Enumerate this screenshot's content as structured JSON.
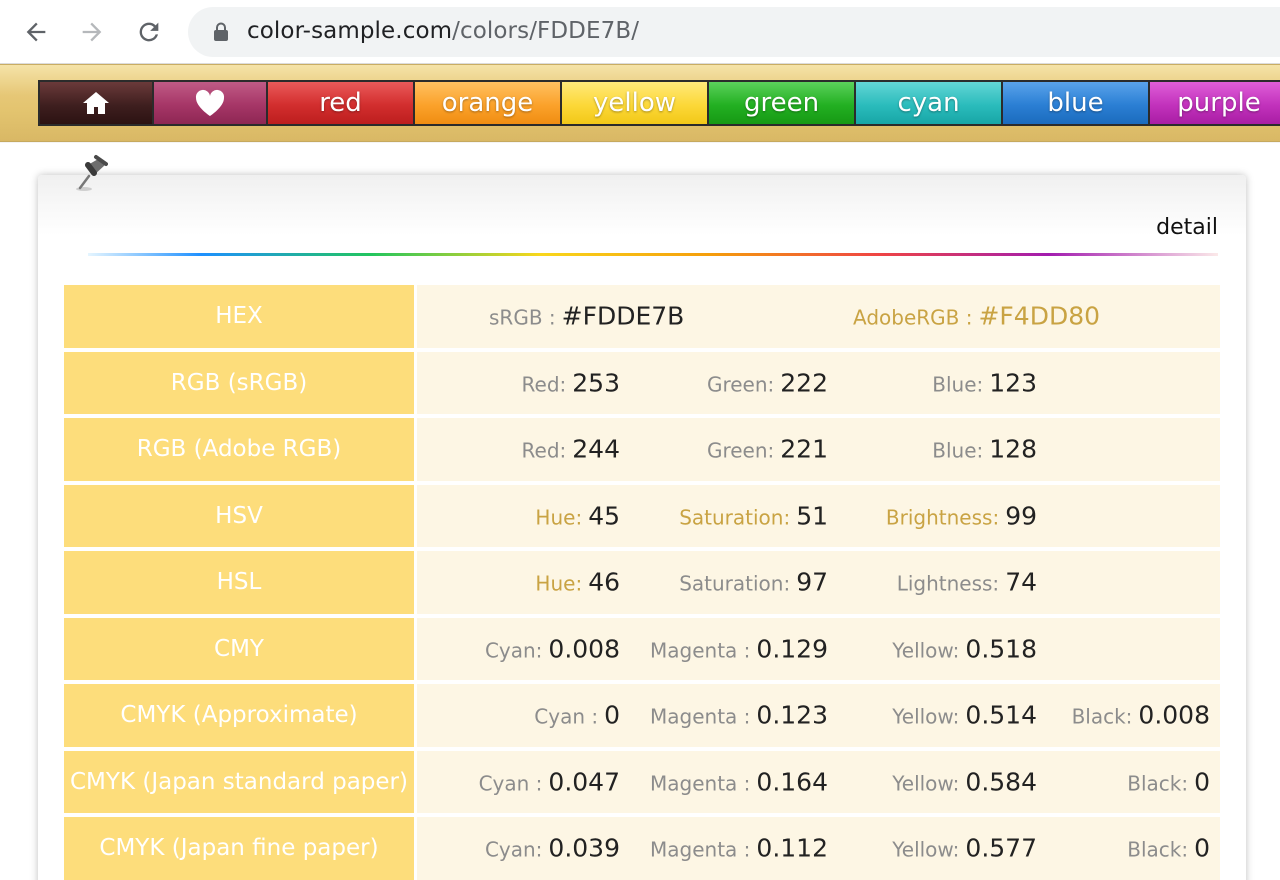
{
  "browser": {
    "url_domain": "color-sample.com",
    "url_path": "/colors/FDDE7B/"
  },
  "color_tabs": [
    {
      "id": "home",
      "label": "",
      "icon": "home-icon"
    },
    {
      "id": "fav",
      "label": "",
      "icon": "heart-icon"
    },
    {
      "id": "red",
      "label": "red"
    },
    {
      "id": "orange",
      "label": "orange"
    },
    {
      "id": "yellow",
      "label": "yellow"
    },
    {
      "id": "green",
      "label": "green"
    },
    {
      "id": "cyan",
      "label": "cyan"
    },
    {
      "id": "blue",
      "label": "blue"
    },
    {
      "id": "purple",
      "label": "purple"
    }
  ],
  "detail": {
    "title": "detail",
    "rows": [
      {
        "label": "HEX",
        "fields": [
          {
            "key": "sRGB :",
            "value": "#FDDE7B"
          },
          {
            "key": "AdobeRGB :",
            "value": "#F4DD80",
            "highlight": true
          }
        ]
      },
      {
        "label": "RGB (sRGB)",
        "fields": [
          {
            "key": "Red:",
            "value": "253"
          },
          {
            "key": "Green:",
            "value": "222"
          },
          {
            "key": "Blue:",
            "value": "123"
          }
        ]
      },
      {
        "label": "RGB (Adobe RGB)",
        "fields": [
          {
            "key": "Red:",
            "value": "244"
          },
          {
            "key": "Green:",
            "value": "221"
          },
          {
            "key": "Blue:",
            "value": "128"
          }
        ]
      },
      {
        "label": "HSV",
        "fields": [
          {
            "key": "Hue:",
            "value": "45",
            "highlight": true
          },
          {
            "key": "Saturation:",
            "value": "51",
            "highlight": true
          },
          {
            "key": "Brightness:",
            "value": "99",
            "highlight": true
          }
        ]
      },
      {
        "label": "HSL",
        "fields": [
          {
            "key": "Hue:",
            "value": "46",
            "highlight": true
          },
          {
            "key": "Saturation:",
            "value": "97"
          },
          {
            "key": "Lightness:",
            "value": "74"
          }
        ]
      },
      {
        "label": "CMY",
        "fields": [
          {
            "key": "Cyan:",
            "value": "0.008"
          },
          {
            "key": "Magenta :",
            "value": "0.129"
          },
          {
            "key": "Yellow:",
            "value": "0.518"
          }
        ]
      },
      {
        "label": "CMYK (Approximate)",
        "fields": [
          {
            "key": "Cyan :",
            "value": "0"
          },
          {
            "key": "Magenta :",
            "value": "0.123"
          },
          {
            "key": "Yellow:",
            "value": "0.514"
          },
          {
            "key": "Black:",
            "value": "0.008"
          }
        ]
      },
      {
        "label": "CMYK (Japan standard paper)",
        "fields": [
          {
            "key": "Cyan :",
            "value": "0.047"
          },
          {
            "key": "Magenta :",
            "value": "0.164"
          },
          {
            "key": "Yellow:",
            "value": "0.584"
          },
          {
            "key": "Black:",
            "value": "0"
          }
        ]
      },
      {
        "label": "CMYK (Japan fine paper)",
        "fields": [
          {
            "key": "Cyan:",
            "value": "0.039"
          },
          {
            "key": "Magenta :",
            "value": "0.112"
          },
          {
            "key": "Yellow:",
            "value": "0.577"
          },
          {
            "key": "Black:",
            "value": "0"
          }
        ]
      }
    ]
  },
  "colors": {
    "label_bg": "#FDDE7B",
    "value_bg": "#FDF6E4",
    "highlight": "#C9A343"
  }
}
